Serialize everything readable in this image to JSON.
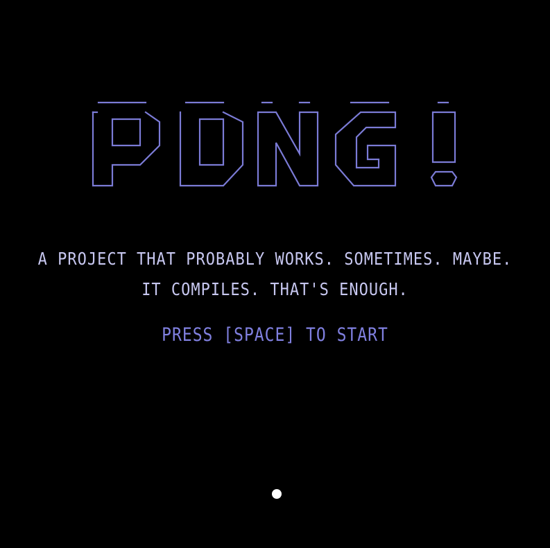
{
  "title_logo": "PONG !",
  "tagline": {
    "line1": "A PROJECT THAT PROBABLY WORKS. SOMETIMES. MAYBE.",
    "line2": "IT COMPILES. THAT'S ENOUGH."
  },
  "prompt": "PRESS [SPACE] TO START",
  "colors": {
    "background": "#000000",
    "logo": "#7b7bd6",
    "tagline": "#c7c7f0",
    "prompt": "#8080e0",
    "ball": "#ffffff"
  }
}
